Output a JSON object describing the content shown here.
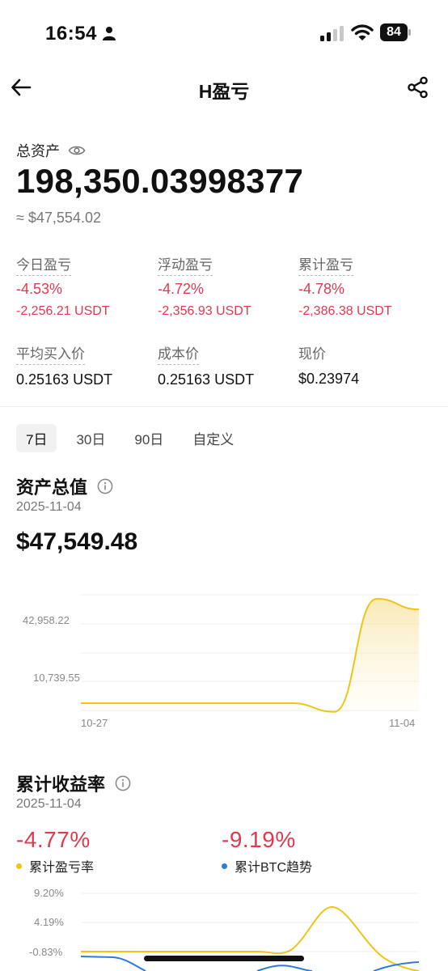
{
  "status_bar": {
    "time": "16:54",
    "battery": "84"
  },
  "header": {
    "title": "H盈亏"
  },
  "assets": {
    "label": "总资产",
    "value": "198,350.03998377",
    "usd": "≈ $47,554.02"
  },
  "stats": [
    {
      "label": "今日盈亏",
      "pct": "-4.53%",
      "amount": "-2,256.21 USDT"
    },
    {
      "label": "浮动盈亏",
      "pct": "-4.72%",
      "amount": "-2,356.93 USDT"
    },
    {
      "label": "累计盈亏",
      "pct": "-4.78%",
      "amount": "-2,386.38 USDT"
    }
  ],
  "prices": [
    {
      "label": "平均买入价",
      "value": "0.25163 USDT"
    },
    {
      "label": "成本价",
      "value": "0.25163 USDT"
    },
    {
      "label": "现价",
      "value": "$0.23974"
    }
  ],
  "tabs": [
    "7日",
    "30日",
    "90日",
    "自定义"
  ],
  "active_tab": "7日",
  "asset_chart": {
    "title": "资产总值",
    "date": "2025-11-04",
    "value": "$47,549.48"
  },
  "return_chart": {
    "title": "累计收益率",
    "date": "2025-11-04",
    "series": [
      {
        "pct": "-4.77%",
        "name": "累计盈亏率",
        "color": "#f0c419"
      },
      {
        "pct": "-9.19%",
        "name": "累计BTC趋势",
        "color": "#2f7bd8"
      }
    ]
  },
  "chart_data": [
    {
      "type": "area",
      "y_ticks": [
        "42,958.22",
        "10,739.55"
      ],
      "x_ticks": [
        "10-27",
        "11-04"
      ],
      "x": [
        "10-27",
        "10-28",
        "10-29",
        "10-30",
        "10-31",
        "11-01",
        "11-02",
        "11-03",
        "11-04"
      ],
      "values": [
        4000,
        4000,
        4000,
        4000,
        4000,
        4000,
        0,
        52500,
        47549.48
      ],
      "color": "#f0c419"
    },
    {
      "type": "line",
      "y_ticks": [
        "9.20%",
        "4.19%",
        "-0.83%"
      ],
      "series": [
        {
          "name": "累计盈亏率",
          "color": "#f0c419"
        },
        {
          "name": "累计BTC趋势",
          "color": "#2f7bd8"
        }
      ]
    }
  ]
}
